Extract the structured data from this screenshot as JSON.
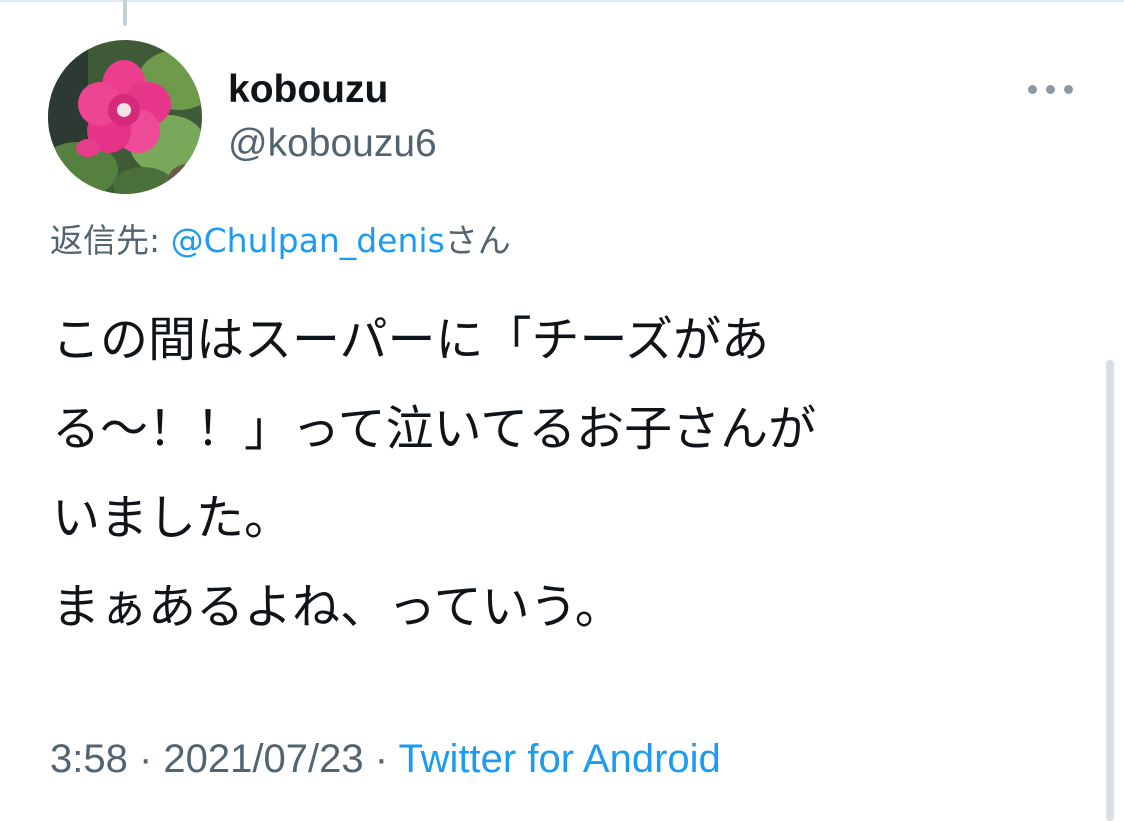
{
  "tweet": {
    "author": {
      "display_name": "kobouzu",
      "handle": "@kobouzu6"
    },
    "reply_to": {
      "prefix": "返信先: ",
      "mention": "@Chulpan_denis",
      "suffix": "さん"
    },
    "body_lines": [
      "この間はスーパーに「チーズがあ",
      "る〜！！」って泣いてるお子さんが",
      "いました。",
      "まぁあるよね、っていう。"
    ],
    "time": "3:58",
    "date": "2021/07/23",
    "source": "Twitter for Android",
    "separator": " · "
  },
  "icons": {
    "more": "more-horizontal-icon"
  },
  "colors": {
    "text_primary": "#0f1419",
    "text_secondary": "#536471",
    "link": "#1d9bf0"
  }
}
